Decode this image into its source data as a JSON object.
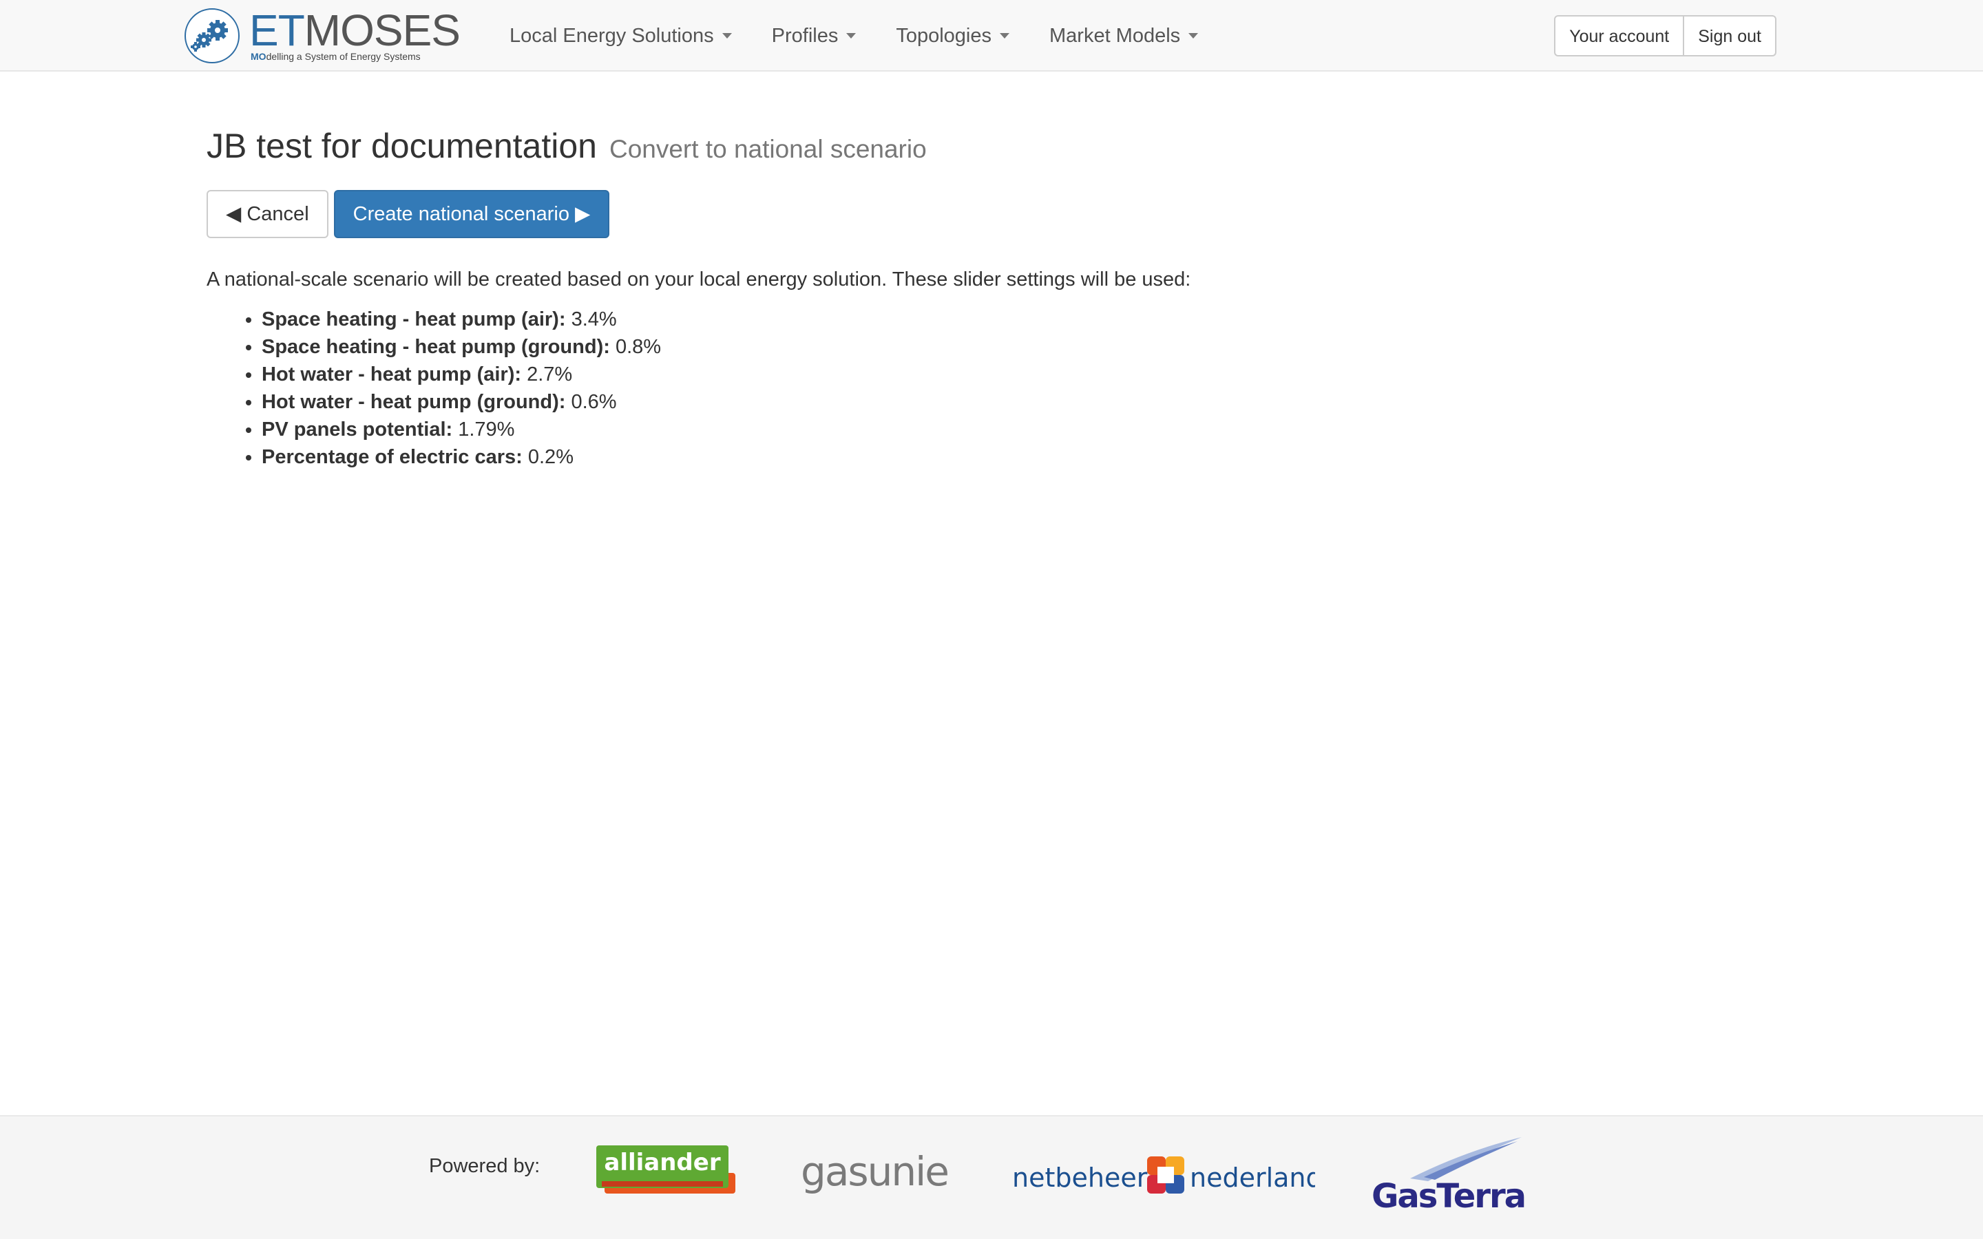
{
  "navbar": {
    "brand": {
      "name_et": "ET",
      "name_moses": "MOSES",
      "tagline_bold": "MO",
      "tagline_rest": "delling a System of Energy Systems"
    },
    "menu": [
      {
        "label": "Local Energy Solutions"
      },
      {
        "label": "Profiles"
      },
      {
        "label": "Topologies"
      },
      {
        "label": "Market Models"
      }
    ],
    "account": {
      "your_account": "Your account",
      "sign_out": "Sign out"
    }
  },
  "page": {
    "title": "JB test for documentation",
    "subtitle": "Convert to national scenario",
    "cancel_label": "◀ Cancel",
    "create_label": "Create national scenario ▶",
    "intro": "A national-scale scenario will be created based on your local energy solution. These slider settings will be used:",
    "settings": [
      {
        "label": "Space heating - heat pump (air):",
        "value": "3.4%"
      },
      {
        "label": "Space heating - heat pump (ground):",
        "value": "0.8%"
      },
      {
        "label": "Hot water - heat pump (air):",
        "value": "2.7%"
      },
      {
        "label": "Hot water - heat pump (ground):",
        "value": "0.6%"
      },
      {
        "label": "PV panels potential:",
        "value": "1.79%"
      },
      {
        "label": "Percentage of electric cars:",
        "value": "0.2%"
      }
    ]
  },
  "footer": {
    "powered_by": "Powered by:",
    "sponsors": [
      {
        "name": "alliander"
      },
      {
        "name": "gasunie"
      },
      {
        "name_left": "netbeheer",
        "name_right": "nederland"
      },
      {
        "name": "GasTerra"
      }
    ]
  },
  "colors": {
    "primary": "#337ab7",
    "navbar_bg": "#f8f8f8",
    "footer_bg": "#f5f5f5",
    "alliander_green": "#5fa933",
    "alliander_orange": "#e8561e",
    "netbeheer_blue": "#1b4f8f",
    "gasterra_blue": "#2a2a84"
  }
}
